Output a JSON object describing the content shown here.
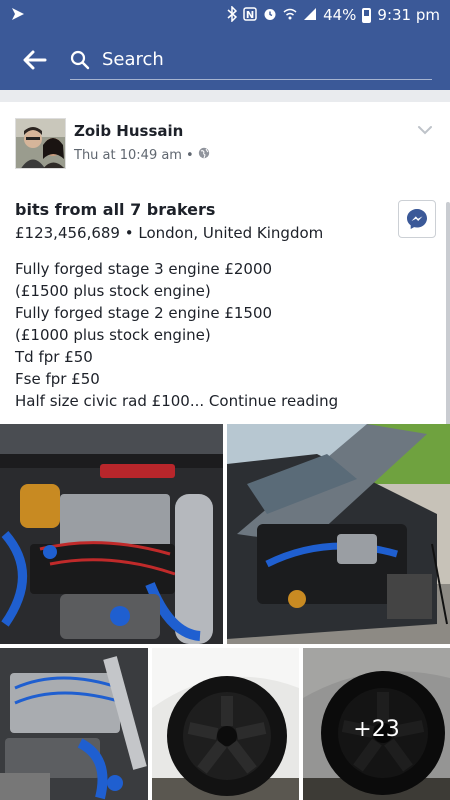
{
  "status_bar": {
    "battery": "44%",
    "time": "9:31 pm"
  },
  "search": {
    "placeholder": "Search"
  },
  "post": {
    "author": "Zoib Hussain",
    "timestamp": "Thu at 10:49 am",
    "separator": "•",
    "title": "bits from all 7 brakers",
    "price_location": "£123,456,689 • London, United Kingdom",
    "body_lines": [
      "Fully forged stage 3 engine £2000",
      "(£1500 plus stock engine)",
      "Fully forged stage 2 engine £1500",
      "(£1000 plus stock engine)",
      "Td fpr £50",
      "Fse fpr £50"
    ],
    "last_line": "Half size civic rad £100...",
    "continue_label": "Continue reading"
  },
  "photos": {
    "more_count": "+23"
  },
  "colors": {
    "brand": "#3b5998",
    "background": "#e9ebee"
  }
}
